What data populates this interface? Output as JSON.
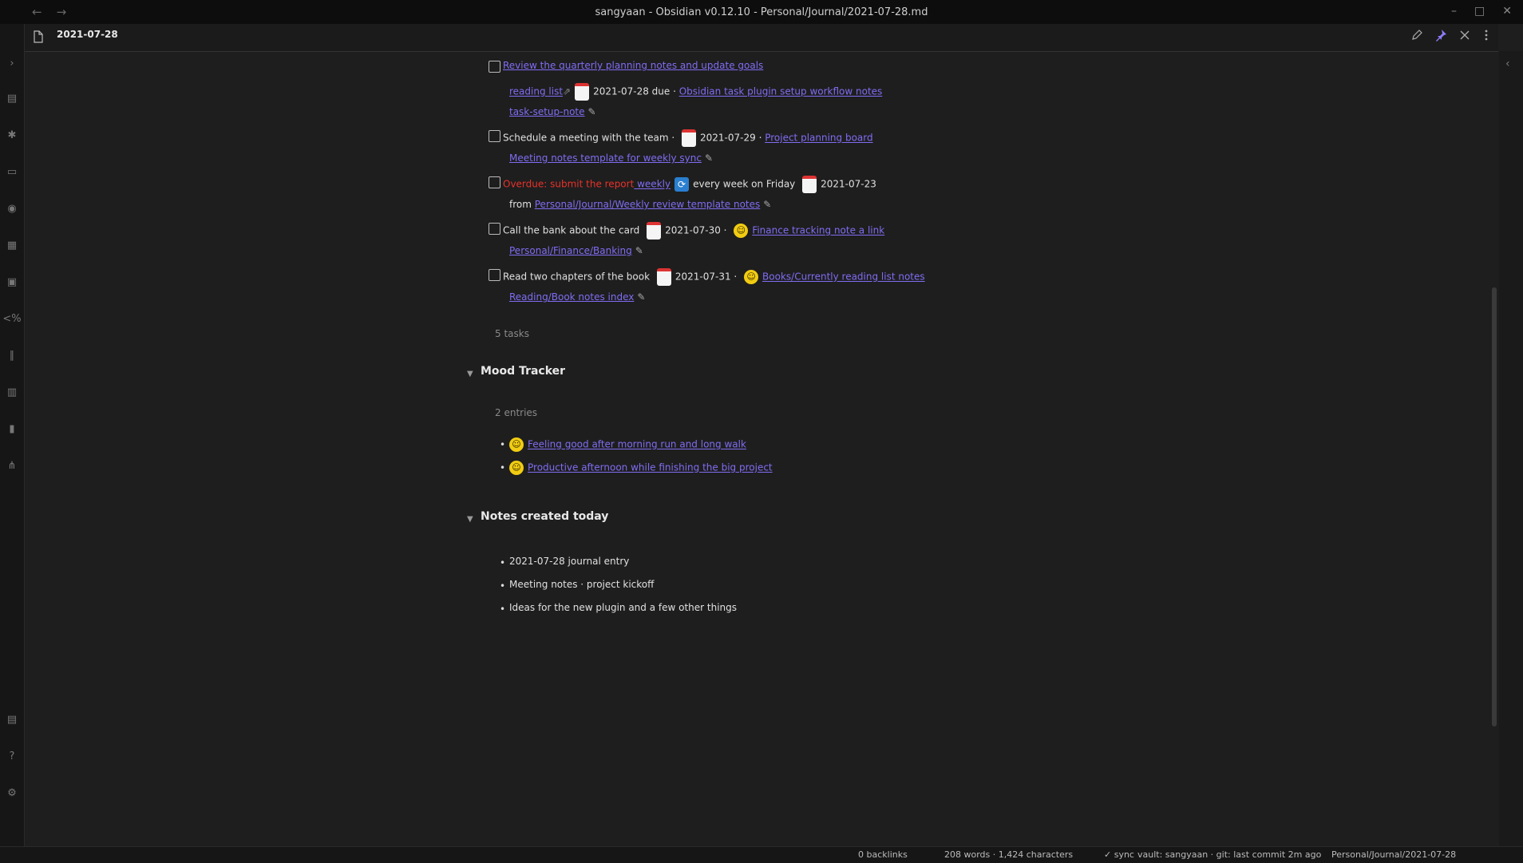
{
  "window": {
    "title": "sangyaan - Obsidian v0.12.10 - Personal/Journal/2021-07-28.md",
    "back": "←",
    "forward": "→",
    "minimize": "–",
    "maximize": "□",
    "close": "✕"
  },
  "header": {
    "note_title": "2021-07-28",
    "actions": [
      "edit-icon",
      "pin-icon",
      "close-icon",
      "more-options-icon"
    ]
  },
  "ribbon_icons": [
    "expand-sidebar-icon",
    "daily-note-icon",
    "graph-view-icon",
    "slides-icon",
    "microphone-icon",
    "kanban-icon",
    "calendar-icon",
    "templater-icon",
    "attachment-icon",
    "table-icon",
    "book-icon",
    "git-icon",
    "vault-icon",
    "help-icon",
    "settings-icon"
  ],
  "tasks": [
    {
      "segments": [
        {
          "t": "link",
          "v": "Review the quarterly planning notes and update goals"
        }
      ]
    },
    {
      "indent": true,
      "segments": [
        {
          "t": "link",
          "v": "reading list"
        },
        {
          "t": "ext",
          "v": "⇗"
        },
        {
          "t": "cal"
        },
        {
          "t": "txt",
          "v": "2021-07-28 due · "
        },
        {
          "t": "link",
          "v": "Obsidian task plugin setup workflow notes"
        }
      ]
    },
    {
      "indent": true,
      "segments": [
        {
          "t": "link",
          "v": "task-setup-note"
        },
        {
          "t": "edit"
        }
      ]
    },
    {
      "segments": [
        {
          "t": "txt",
          "v": "Schedule a meeting with the team · "
        },
        {
          "t": "cal"
        },
        {
          "t": "txt",
          "v": "2021-07-29 · "
        },
        {
          "t": "link",
          "v": "Project planning board"
        }
      ]
    },
    {
      "indent": true,
      "segments": [
        {
          "t": "link",
          "v": "Meeting notes template for weekly sync"
        },
        {
          "t": "edit"
        }
      ]
    },
    {
      "segments": [
        {
          "t": "red",
          "v": "Overdue: submit the report"
        },
        {
          "t": "link",
          "v": " weekly"
        },
        {
          "t": "recur"
        },
        {
          "t": "txt",
          "v": "every week on Friday "
        },
        {
          "t": "cal"
        },
        {
          "t": "txt",
          "v": "2021-07-23"
        }
      ]
    },
    {
      "indent": true,
      "segments": [
        {
          "t": "txt",
          "v": "from "
        },
        {
          "t": "link",
          "v": "Personal/Journal/Weekly review template notes"
        },
        {
          "t": "edit"
        }
      ]
    },
    {
      "segments": [
        {
          "t": "txt",
          "v": "Call the bank about the card "
        },
        {
          "t": "cal"
        },
        {
          "t": "txt",
          "v": "2021-07-30 · "
        },
        {
          "t": "smile"
        },
        {
          "t": "link",
          "v": "Finance tracking note a link"
        }
      ]
    },
    {
      "indent": true,
      "segments": [
        {
          "t": "link",
          "v": "Personal/Finance/Banking"
        },
        {
          "t": "edit"
        }
      ]
    },
    {
      "segments": [
        {
          "t": "txt",
          "v": "Read two chapters of the book "
        },
        {
          "t": "cal"
        },
        {
          "t": "txt",
          "v": "2021-07-31 · "
        },
        {
          "t": "smile"
        },
        {
          "t": "link",
          "v": "Books/Currently reading list notes"
        }
      ]
    },
    {
      "indent": true,
      "segments": [
        {
          "t": "link",
          "v": "Reading/Book notes index"
        },
        {
          "t": "edit"
        }
      ]
    }
  ],
  "query_footer_1": "5 tasks",
  "sections": [
    {
      "heading": "Mood Tracker",
      "footer": "2 entries",
      "items": [
        "Feeling good after morning run and long walk",
        "Productive afternoon while finishing the big project"
      ]
    },
    {
      "heading": "Notes created today",
      "items": [
        "2021-07-28 journal entry",
        "Meeting notes · project kickoff",
        "Ideas for the new plugin and a few other things"
      ]
    }
  ],
  "status_bar": [
    "0 backlinks",
    "208 words · 1,424 characters",
    "✓ sync",
    "vault: sangyaan · git: last commit 2m ago",
    "Personal/Journal/2021-07-28"
  ]
}
